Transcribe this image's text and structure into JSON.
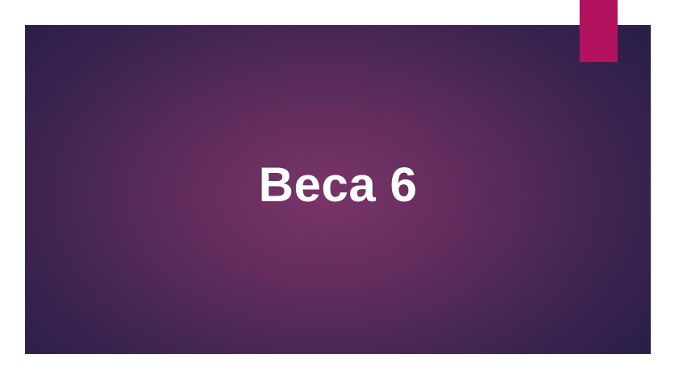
{
  "slide": {
    "title": "Beca 6"
  },
  "colors": {
    "background_center": "#7a3468",
    "background_edge": "#2b1f48",
    "accent": "#b3125f",
    "text": "#ffffff"
  }
}
